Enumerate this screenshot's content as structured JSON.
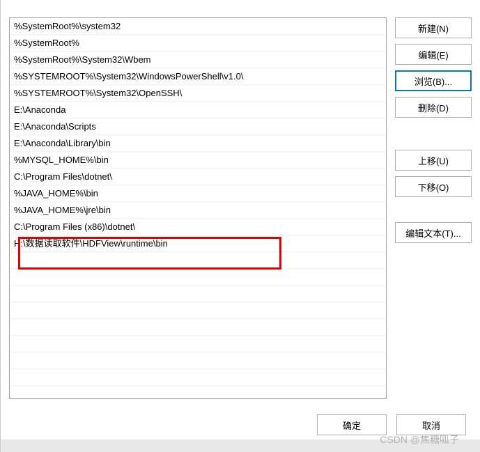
{
  "paths": [
    "%SystemRoot%\\system32",
    "%SystemRoot%",
    "%SystemRoot%\\System32\\Wbem",
    "%SYSTEMROOT%\\System32\\WindowsPowerShell\\v1.0\\",
    "%SYSTEMROOT%\\System32\\OpenSSH\\",
    "E:\\Anaconda",
    "E:\\Anaconda\\Scripts",
    "E:\\Anaconda\\Library\\bin",
    "%MYSQL_HOME%\\bin",
    "C:\\Program Files\\dotnet\\",
    "%JAVA_HOME%\\bin",
    "%JAVA_HOME%\\jre\\bin",
    "C:\\Program Files (x86)\\dotnet\\",
    "H:\\数据读取软件\\HDFView\\runtime\\bin"
  ],
  "buttons": {
    "new": "新建(N)",
    "edit": "编辑(E)",
    "browse": "浏览(B)...",
    "delete": "删除(D)",
    "moveUp": "上移(U)",
    "moveDown": "下移(O)",
    "editText": "编辑文本(T)...",
    "ok": "确定",
    "cancel": "取消"
  },
  "watermark": "CSDN @焦糖呱子",
  "highlightedIndex": 13,
  "emptyRows": 8
}
